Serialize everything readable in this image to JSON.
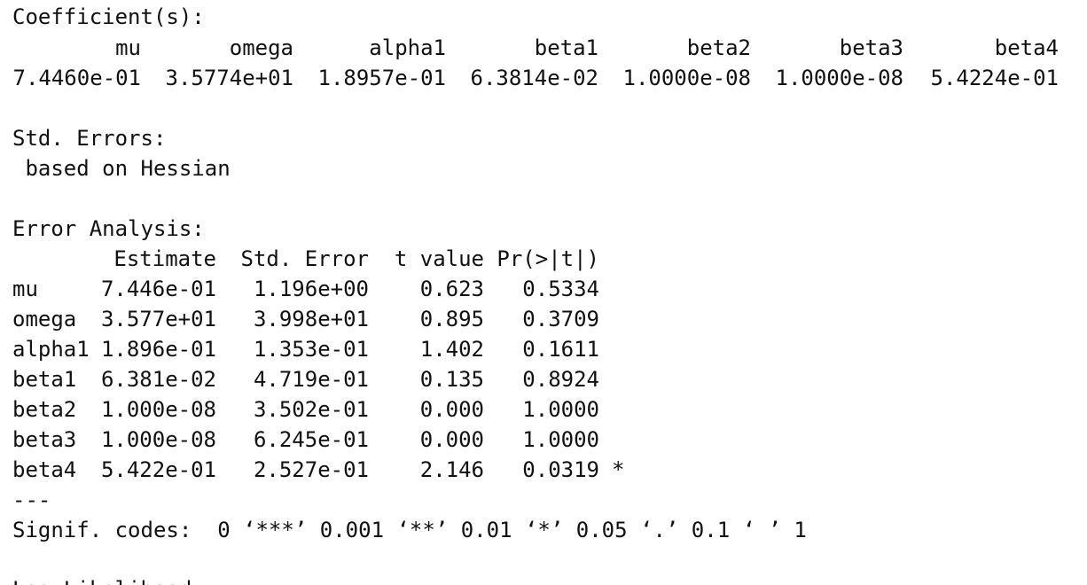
{
  "coefficients": {
    "heading": "Coefficient(s):",
    "names": [
      "mu",
      "omega",
      "alpha1",
      "beta1",
      "beta2",
      "beta3",
      "beta4"
    ],
    "values": [
      "7.4460e-01",
      "3.5774e+01",
      "1.8957e-01",
      "6.3814e-02",
      "1.0000e-08",
      "1.0000e-08",
      "5.4224e-01"
    ]
  },
  "std_errors": {
    "heading": "Std. Errors:",
    "note": " based on Hessian"
  },
  "error_analysis": {
    "heading": "Error Analysis:",
    "columns": [
      "Estimate",
      "Std. Error",
      "t value",
      "Pr(>|t|)"
    ],
    "rows": [
      {
        "name": "mu",
        "estimate": "7.446e-01",
        "std_error": "1.196e+00",
        "t_value": "0.623",
        "p_value": "0.5334",
        "signif": ""
      },
      {
        "name": "omega",
        "estimate": "3.577e+01",
        "std_error": "3.998e+01",
        "t_value": "0.895",
        "p_value": "0.3709",
        "signif": ""
      },
      {
        "name": "alpha1",
        "estimate": "1.896e-01",
        "std_error": "1.353e-01",
        "t_value": "1.402",
        "p_value": "0.1611",
        "signif": ""
      },
      {
        "name": "beta1",
        "estimate": "6.381e-02",
        "std_error": "4.719e-01",
        "t_value": "0.135",
        "p_value": "0.8924",
        "signif": ""
      },
      {
        "name": "beta2",
        "estimate": "1.000e-08",
        "std_error": "3.502e-01",
        "t_value": "0.000",
        "p_value": "1.0000",
        "signif": ""
      },
      {
        "name": "beta3",
        "estimate": "1.000e-08",
        "std_error": "6.245e-01",
        "t_value": "0.000",
        "p_value": "1.0000",
        "signif": ""
      },
      {
        "name": "beta4",
        "estimate": "5.422e-01",
        "std_error": "2.527e-01",
        "t_value": "2.146",
        "p_value": "0.0319",
        "signif": "*"
      }
    ]
  },
  "separator": "---",
  "signif_codes": "Signif. codes:  0 ‘***’ 0.001 ‘**’ 0.01 ‘*’ 0.05 ‘.’ 0.1 ‘ ’ 1",
  "cut_off_line": "Log Likelihood:"
}
